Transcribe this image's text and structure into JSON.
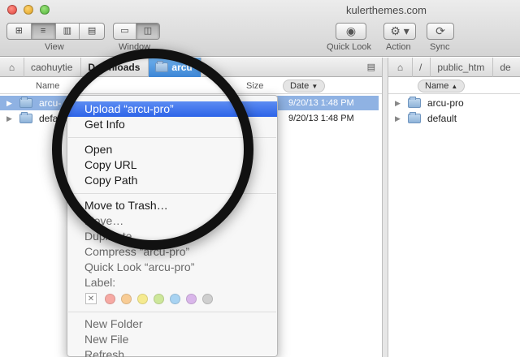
{
  "window": {
    "title": "kulerthemes.com"
  },
  "toolbar": {
    "view_label": "View",
    "window_label": "Window",
    "quicklook_label": "Quick Look",
    "action_label": "Action",
    "sync_label": "Sync",
    "icons": {
      "view_icon": "icon-view",
      "list_icon": "list-view",
      "column_icon": "column-view",
      "coverflow_icon": "coverflow-view",
      "single_icon": "single-pane",
      "dual_icon": "dual-pane",
      "eye_icon": "eye-icon",
      "gear_icon": "gear-icon",
      "sync_icon": "sync-icon"
    }
  },
  "left_pane": {
    "path": [
      "caohuytie",
      "Downloads",
      "arcu"
    ],
    "columns": {
      "name": "Name",
      "size": "Size",
      "date": "Date"
    },
    "rows": [
      {
        "name": "arcu-",
        "date": "9/20/13 1:48 PM",
        "selected": true
      },
      {
        "name": "default",
        "date": "9/20/13 1:48 PM",
        "selected": false
      }
    ]
  },
  "right_pane": {
    "path": [
      "/",
      "public_htm",
      "de"
    ],
    "columns": {
      "name": "Name"
    },
    "rows": [
      {
        "name": "arcu-pro"
      },
      {
        "name": "default"
      }
    ]
  },
  "context_menu": {
    "group1": [
      "Upload “arcu-pro”",
      "Get Info"
    ],
    "group2": [
      "Open",
      "Copy URL",
      "Copy Path"
    ],
    "group3": [
      "Move to Trash…",
      "Move…",
      "Duplicate",
      "Compress “arcu-pro”",
      "Quick Look “arcu-pro”"
    ],
    "label_title": "Label:",
    "label_colors": [
      "#f6a9a3",
      "#f8cc95",
      "#f5ea8f",
      "#cde79a",
      "#a8d3f2",
      "#d9b6ea",
      "#cfcfcf"
    ],
    "group4": [
      "New Folder",
      "New File",
      "Refresh"
    ]
  }
}
